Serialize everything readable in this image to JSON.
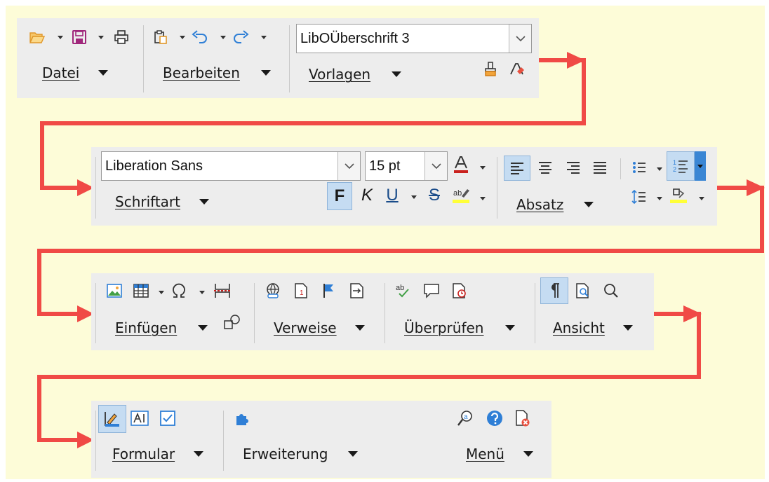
{
  "toolbar1": {
    "menus": {
      "file": "Datei",
      "edit": "Bearbeiten",
      "styles": "Vorlagen"
    },
    "style_combo_value": "LibOÜberschrift 3"
  },
  "toolbar2": {
    "font_combo_value": "Liberation Sans",
    "size_combo_value": "15 pt",
    "bold": "F",
    "italic": "K",
    "underline": "U",
    "strike": "S",
    "menus": {
      "font": "Schriftart",
      "paragraph": "Absatz"
    }
  },
  "toolbar3": {
    "menus": {
      "insert": "Einfügen",
      "references": "Verweise",
      "review": "Überprüfen",
      "view": "Ansicht"
    }
  },
  "toolbar4": {
    "menus": {
      "form": "Formular",
      "extension": "Erweiterung",
      "menu": "Menü"
    }
  },
  "colors": {
    "background": "#fdfcd8",
    "toolbar": "#ededed",
    "arrow": "#f04a46",
    "accent": "#3a86d4",
    "toggle_active": "#c5dcf2"
  },
  "icons": [
    "open-icon",
    "save-icon",
    "print-icon",
    "paste-icon",
    "undo-icon",
    "redo-icon",
    "clone-formatting-icon",
    "clear-formatting-icon",
    "font-color-icon",
    "highlight-icon",
    "align-left-icon",
    "align-center-icon",
    "align-right-icon",
    "justify-icon",
    "bullets-icon",
    "numbering-icon",
    "line-spacing-icon",
    "paragraph-background-icon",
    "image-icon",
    "table-icon",
    "special-character-icon",
    "page-break-icon",
    "shapes-icon",
    "hyperlink-icon",
    "footnote-icon",
    "bookmark-icon",
    "cross-reference-icon",
    "spelling-icon",
    "comment-icon",
    "track-changes-icon",
    "formatting-marks-icon",
    "print-preview-icon",
    "find-icon",
    "design-mode-icon",
    "text-field-icon",
    "checkbox-icon",
    "extension-icon",
    "accessibility-icon",
    "help-icon",
    "close-document-icon"
  ]
}
